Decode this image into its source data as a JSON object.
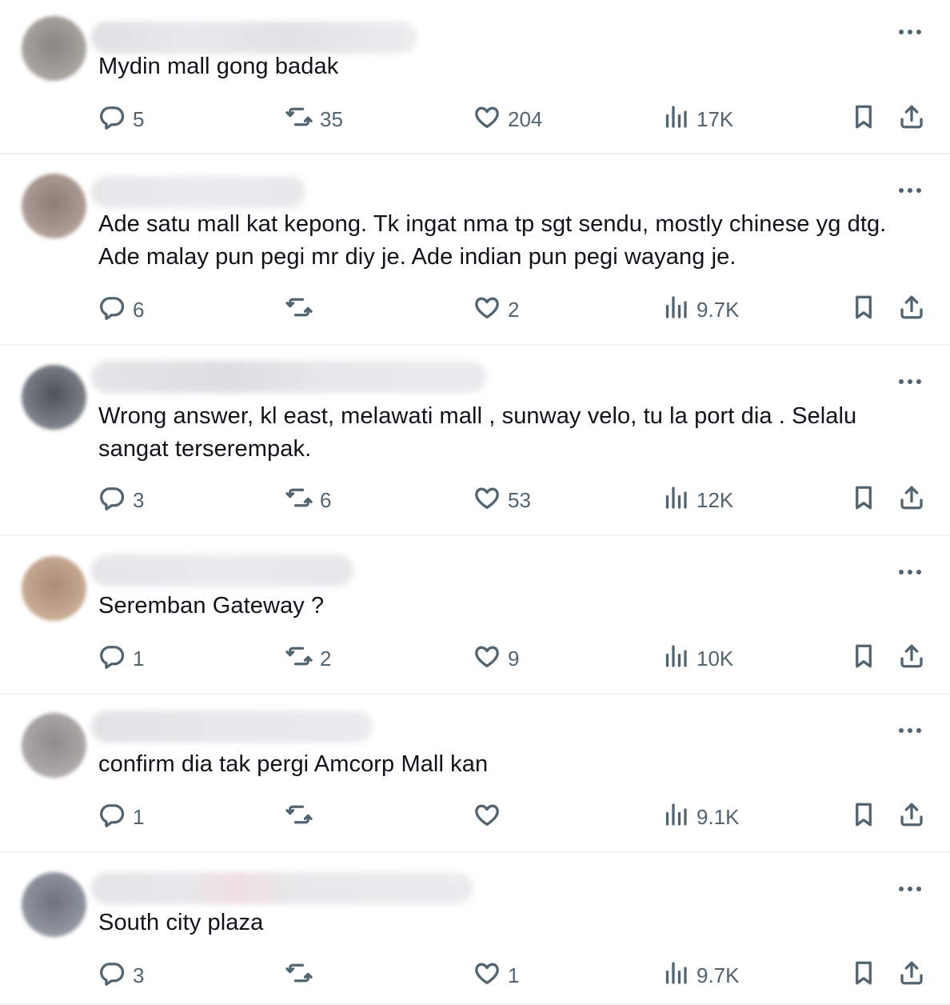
{
  "colors": {
    "text_primary": "#0f1419",
    "text_secondary": "#536471",
    "divider": "#eff3f4"
  },
  "icons": {
    "reply": "speech-bubble-icon",
    "retweet": "retweet-arrows-icon",
    "like": "heart-icon",
    "views": "bar-chart-icon",
    "bookmark": "bookmark-icon",
    "share": "share-upload-icon",
    "more": "more-dots-icon"
  },
  "replies": [
    {
      "text": "Mydin mall gong badak",
      "stats": {
        "replies": "5",
        "reposts": "35",
        "likes": "204",
        "views": "17K"
      }
    },
    {
      "text": "Ade satu mall kat kepong. Tk ingat nma tp sgt sendu, mostly chinese yg dtg. Ade malay pun pegi mr diy je. Ade indian pun pegi wayang je.",
      "stats": {
        "replies": "6",
        "reposts": "",
        "likes": "2",
        "views": "9.7K"
      }
    },
    {
      "text": "Wrong answer, kl east, melawati mall , sunway velo, tu la port dia . Selalu sangat terserempak.",
      "stats": {
        "replies": "3",
        "reposts": "6",
        "likes": "53",
        "views": "12K"
      }
    },
    {
      "text": "Seremban Gateway ?",
      "stats": {
        "replies": "1",
        "reposts": "2",
        "likes": "9",
        "views": "10K"
      }
    },
    {
      "text": "confirm dia tak pergi Amcorp Mall kan",
      "stats": {
        "replies": "1",
        "reposts": "",
        "likes": "",
        "views": "9.1K"
      }
    },
    {
      "text": "South city plaza",
      "stats": {
        "replies": "3",
        "reposts": "",
        "likes": "1",
        "views": "9.7K"
      }
    }
  ]
}
